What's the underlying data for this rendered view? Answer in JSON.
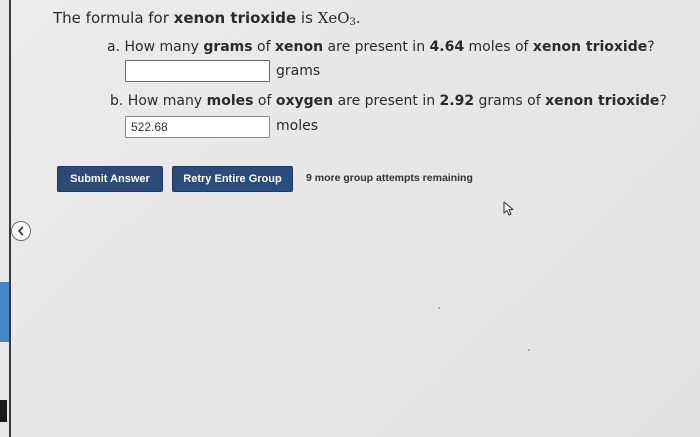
{
  "intro": {
    "prefix": "The formula for ",
    "compound": "xenon trioxide",
    "mid": " is ",
    "formula_base": "XeO",
    "formula_sub": "3",
    "suffix": "."
  },
  "question_a": {
    "p1": "a. How many ",
    "b1": "grams",
    "p2": " of ",
    "b2": "xenon",
    "p3": " are present in ",
    "b3": "4.64",
    "p4": " moles of ",
    "b4": "xenon trioxide",
    "p5": "?",
    "value": "",
    "unit": "grams"
  },
  "question_b": {
    "p1": "b. How many ",
    "b1": "moles",
    "p2": " of ",
    "b2": "oxygen",
    "p3": " are present in ",
    "b3": "2.92",
    "p4": " grams of ",
    "b4": "xenon trioxide",
    "p5": "?",
    "value": "522.68",
    "unit": "moles"
  },
  "buttons": {
    "submit": "Submit Answer",
    "retry": "Retry Entire Group"
  },
  "attempts_text": "9 more group attempts remaining",
  "colors": {
    "button_bg": "#2b4a78",
    "sidebar_accent": "#4a87c8"
  },
  "icons": {
    "collapse": "chevron-left-icon",
    "cursor": "mouse-cursor-icon"
  }
}
